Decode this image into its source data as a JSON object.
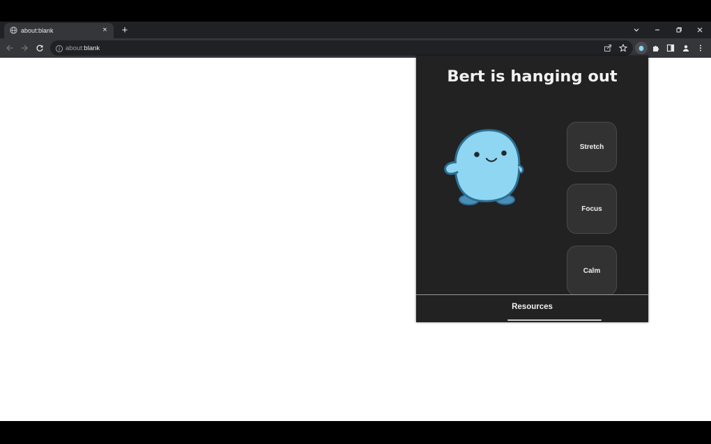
{
  "browser": {
    "tab": {
      "title": "about:blank",
      "favicon": "globe-icon",
      "close_icon": "×"
    },
    "new_tab_icon": "+",
    "window_controls": [
      "chevron-down-icon",
      "minimize-icon",
      "restore-icon",
      "close-icon"
    ],
    "toolbar": {
      "back_icon": "arrow-left-icon",
      "forward_icon": "arrow-right-icon",
      "reload_icon": "reload-icon",
      "address": {
        "scheme": "about:",
        "host": "blank",
        "info_icon": "info-icon"
      },
      "right_icons": [
        "share-icon",
        "star-icon",
        "bert-extension-icon",
        "puzzle-icon",
        "sidepanel-icon",
        "profile-icon",
        "kebab-menu-icon"
      ]
    }
  },
  "popup": {
    "title": "Bert is hanging out",
    "mascot": "bert-mascot",
    "buttons": [
      {
        "label": "Stretch"
      },
      {
        "label": "Focus"
      },
      {
        "label": "Calm"
      }
    ],
    "footer": {
      "label": "Resources"
    }
  },
  "colors": {
    "titlebar": "#202124",
    "toolbar": "#35363a",
    "popup_bg": "#222222",
    "button_bg": "#323232",
    "mascot_body": "#8ed6f2",
    "mascot_outline": "#2c6f93"
  }
}
